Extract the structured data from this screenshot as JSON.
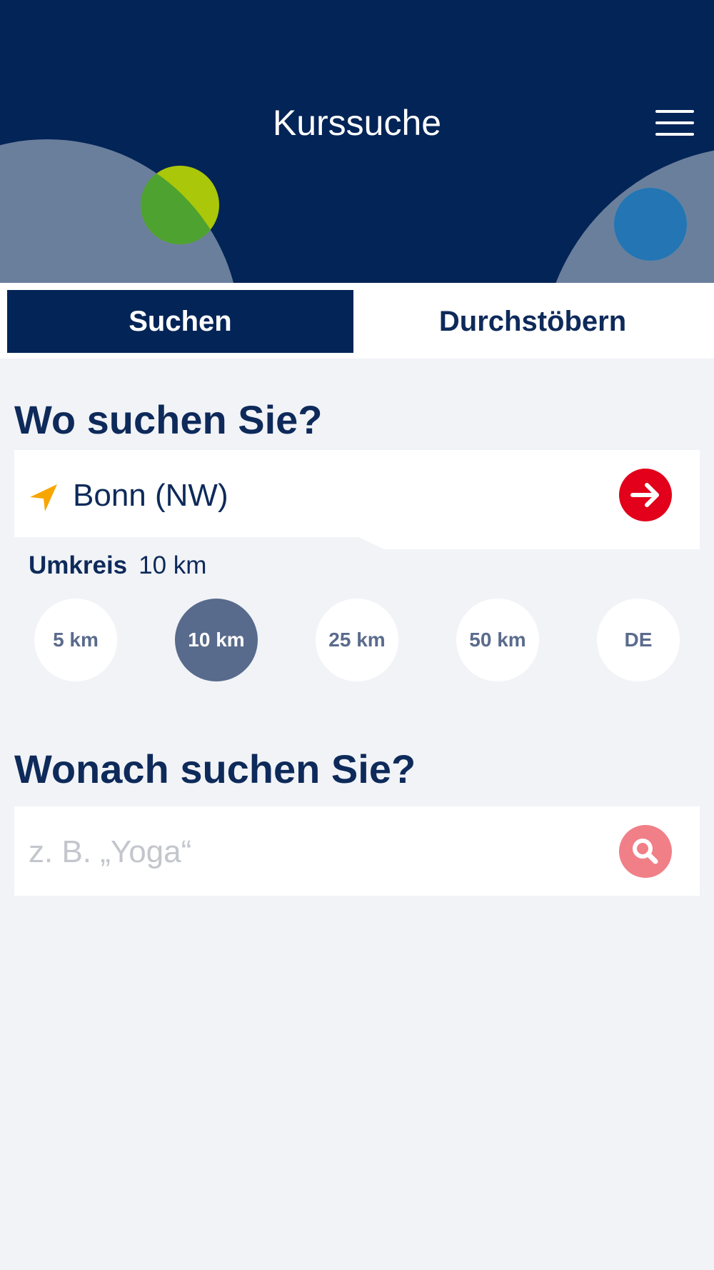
{
  "app": {
    "title": "Kurssuche"
  },
  "header": {
    "menu_icon": "hamburger-menu-icon"
  },
  "tabs": [
    {
      "label": "Suchen",
      "active": true
    },
    {
      "label": "Durchstöbern",
      "active": false
    }
  ],
  "location": {
    "heading": "Wo suchen Sie?",
    "icon": "location-arrow-icon",
    "value": "Bonn (NW)",
    "go_icon": "arrow-right-icon"
  },
  "radius": {
    "label": "Umkreis",
    "value": "10 km",
    "options": [
      "5 km",
      "10 km",
      "25 km",
      "50 km",
      "DE"
    ],
    "selected": "10 km"
  },
  "search": {
    "heading": "Wonach suchen Sie?",
    "placeholder": "z. B. „Yoga“",
    "value": "",
    "icon": "search-icon"
  },
  "colors": {
    "header_bg": "#032456",
    "accent_red": "#e2001a",
    "search_button": "#f07f87",
    "radius_active": "#596b8c",
    "page_bg": "#f1f3f7"
  }
}
